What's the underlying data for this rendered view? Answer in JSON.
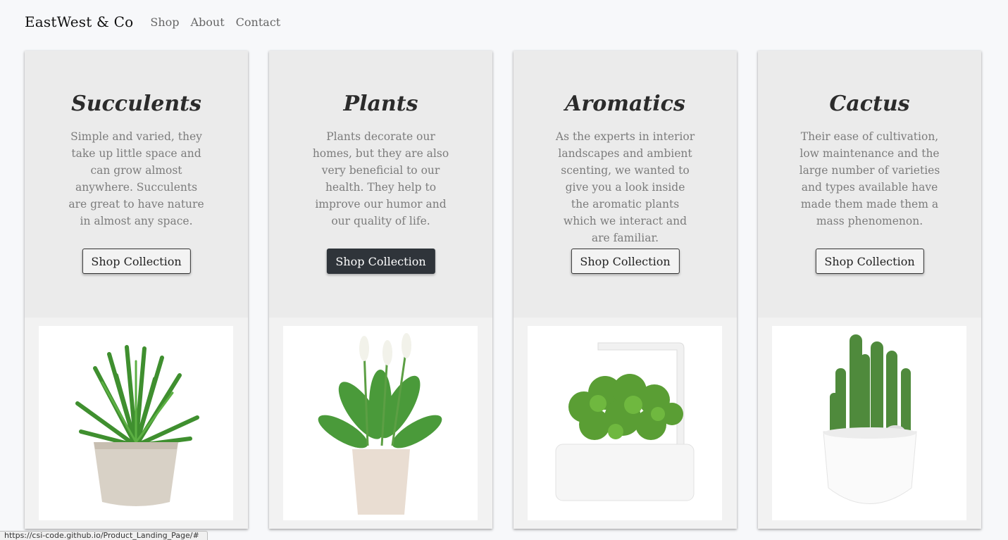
{
  "nav": {
    "brand": "EastWest & Co",
    "links": [
      "Shop",
      "About",
      "Contact"
    ]
  },
  "cards": [
    {
      "title": "Succulents",
      "description": "Simple and varied, they take up little space and can grow almost anywhere. Succulents are great to have nature in almost any space.",
      "button": "Shop Collection",
      "image": "succulent-in-stone-pot"
    },
    {
      "title": "Plants",
      "description": "Plants decorate our homes, but they are also very beneficial to our health. They help to improve our humor and our quality of life.",
      "button": "Shop Collection",
      "image": "peace-lily-in-pot"
    },
    {
      "title": "Aromatics",
      "description": "As the experts in interior landscapes and ambient scenting, we wanted to give you a look inside the aromatic plants which we interact and are familiar.",
      "button": "Shop Collection",
      "image": "basil-smart-garden"
    },
    {
      "title": "Cactus",
      "description": "Their ease of cultivation, low maintenance and the large number of varieties and types available have made them made them a mass phenomenon.",
      "button": "Shop Collection",
      "image": "cactus-in-white-pot"
    }
  ],
  "status_url": "https://csi-code.github.io/Product_Landing_Page/#",
  "colors": {
    "page_bg": "#f7f8fa",
    "card_bg": "#ebebeb",
    "button_active": "#2f343a"
  }
}
